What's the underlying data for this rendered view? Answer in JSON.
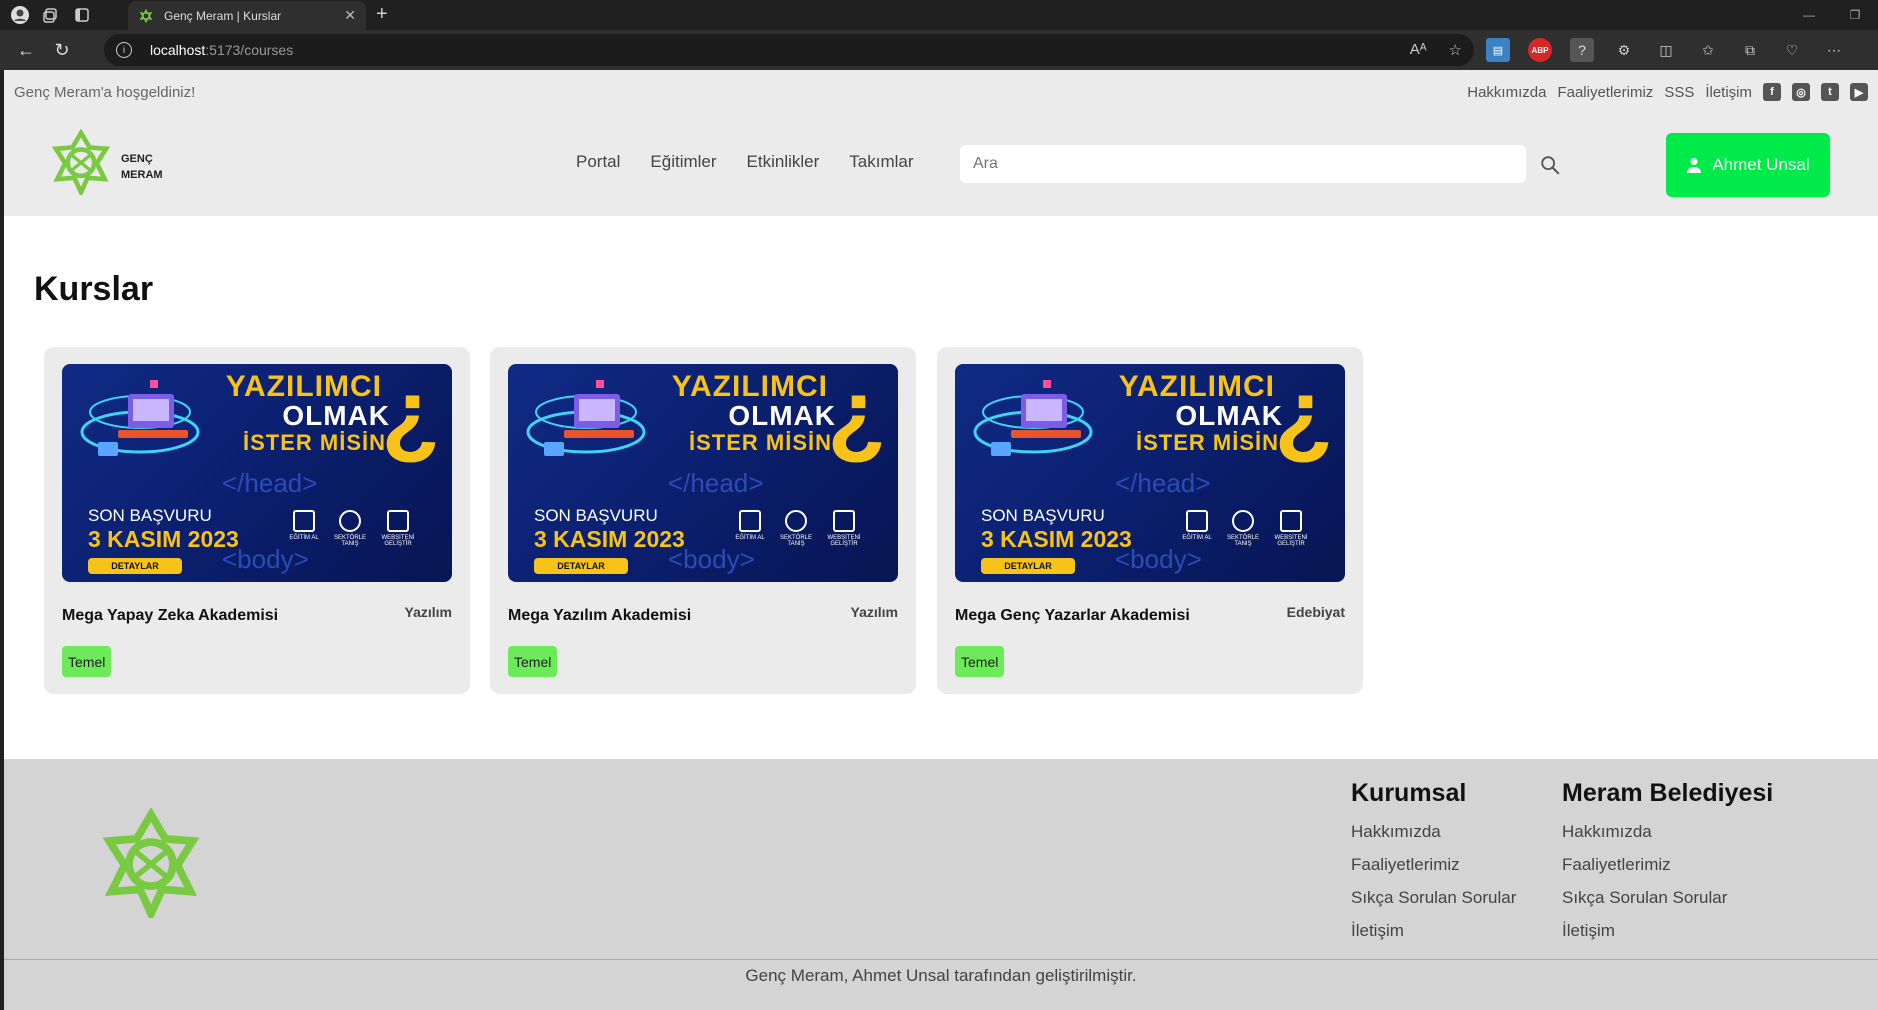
{
  "browser": {
    "tab_title": "Genç Meram | Kurslar",
    "url_host": "localhost",
    "url_path": ":5173/courses",
    "icons": [
      "profile-icon",
      "workspaces-icon",
      "tab-actions-icon",
      "back-icon",
      "refresh-icon",
      "info-icon",
      "read-aloud-icon",
      "favorite-icon",
      "extensions-icon",
      "split-screen-icon",
      "favorites-icon",
      "collections-icon",
      "health-icon",
      "more-icon"
    ],
    "read_aloud": "Aᴬ",
    "ext_abp": "ABP"
  },
  "topbar": {
    "welcome": "Genç Meram'a hoşgeldiniz!",
    "links": [
      "Hakkımızda",
      "Faaliyetlerimiz",
      "SSS",
      "İletişim"
    ],
    "social": [
      "f",
      "◎",
      "t",
      "▶"
    ]
  },
  "header": {
    "logo_line1": "GENÇ",
    "logo_line2": "MERAM",
    "nav": [
      "Portal",
      "Eğitimler",
      "Etkinlikler",
      "Takımlar"
    ],
    "search_placeholder": "Ara",
    "user_name": "Ahmet Unsal"
  },
  "main": {
    "title": "Kurslar",
    "banner": {
      "line1": "YAZILIMCI",
      "line2": "OLMAK",
      "line3": "İSTER MİSİN",
      "question": "¿",
      "code1": "</head>",
      "code2": "<body>",
      "deadline_label": "SON BAŞVURU",
      "deadline_date": "3 KASIM 2023",
      "details": "DETAYLAR",
      "icon_labels": [
        "EĞİTİM AL",
        "SEKTÖRLE TANIŞ",
        "WEBSİTENİ GELİŞTİR"
      ]
    },
    "courses": [
      {
        "title": "Mega Yapay Zeka Akademisi",
        "category": "Yazılım",
        "level": "Temel"
      },
      {
        "title": "Mega Yazılım Akademisi",
        "category": "Yazılım",
        "level": "Temel"
      },
      {
        "title": "Mega Genç Yazarlar Akademisi",
        "category": "Edebiyat",
        "level": "Temel"
      }
    ]
  },
  "footer": {
    "col1": {
      "title": "Kurumsal",
      "links": [
        "Hakkımızda",
        "Faaliyetlerimiz",
        "Sıkça Sorulan Sorular",
        "İletişim"
      ]
    },
    "col2": {
      "title": "Meram Belediyesi",
      "links": [
        "Hakkımızda",
        "Faaliyetlerimiz",
        "Sıkça Sorulan Sorular",
        "İletişim"
      ]
    },
    "copyright": "Genç Meram, Ahmet Unsal tarafından geliştirilmiştir."
  },
  "colors": {
    "accent": "#00ea4a",
    "level_badge": "#6dea5a",
    "logo_green": "#7ac943",
    "banner_blue": "#0a1e6b",
    "banner_yellow": "#f8c318"
  }
}
